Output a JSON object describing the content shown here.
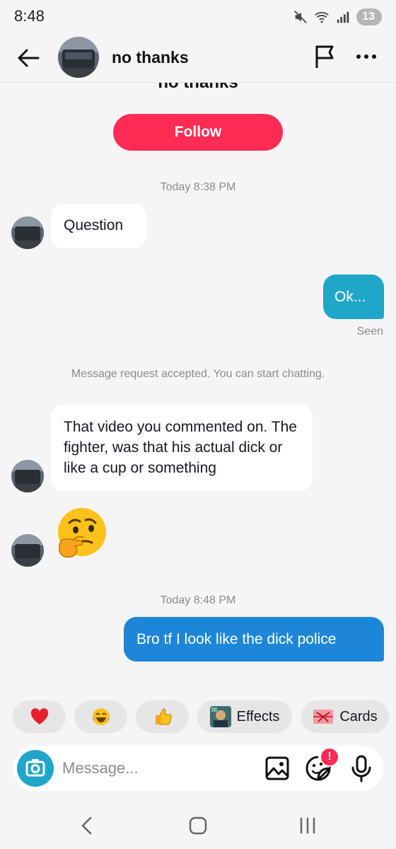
{
  "status_bar": {
    "time": "8:48",
    "battery": "13"
  },
  "header": {
    "name": "no thanks"
  },
  "profile": {
    "clipped_name": "no thanks",
    "follow_label": "Follow"
  },
  "messages": {
    "time1": "Today 8:38 PM",
    "m1": "Question",
    "m2": "Ok...",
    "seen": "Seen",
    "system": "Message request accepted. You can start chatting.",
    "m3": "That video you commented on. The fighter, was that his actual dick or like a cup or something",
    "time2": "Today 8:48 PM",
    "m5": "Bro tf I look like the dick police"
  },
  "quick_actions": {
    "effects": "Effects",
    "cards": "Cards"
  },
  "composer": {
    "placeholder": "Message...",
    "badge": "!"
  },
  "colors": {
    "accent": "#fe2c55",
    "teal_bubble": "#20a6c9",
    "blue_bubble": "#1e86d9"
  }
}
